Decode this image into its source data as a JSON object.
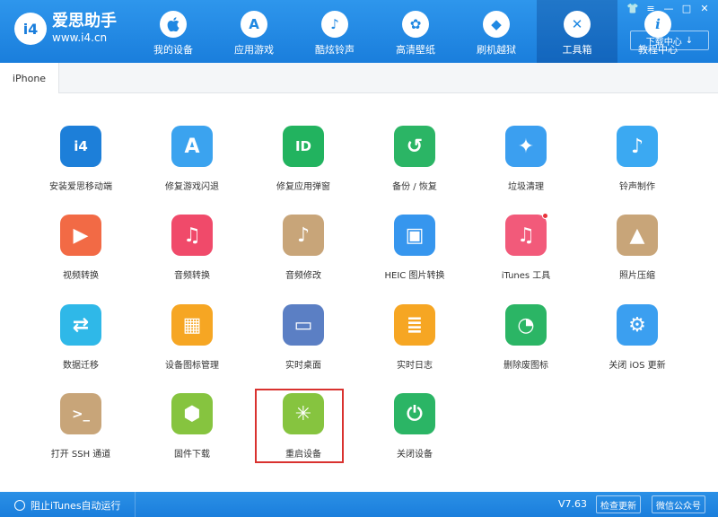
{
  "app": {
    "logo_text": "i4",
    "name": "爱思助手",
    "url": "www.i4.cn"
  },
  "nav": [
    {
      "label": "我的设备",
      "icon": "apple-icon",
      "glyph": ""
    },
    {
      "label": "应用游戏",
      "icon": "app-store-icon",
      "glyph": "A"
    },
    {
      "label": "酷炫铃声",
      "icon": "bell-icon",
      "glyph": "♪"
    },
    {
      "label": "高清壁纸",
      "icon": "flower-icon",
      "glyph": "✿"
    },
    {
      "label": "刷机越狱",
      "icon": "box-icon",
      "glyph": "◆"
    },
    {
      "label": "工具箱",
      "icon": "tools-icon",
      "glyph": "✕",
      "active": true
    },
    {
      "label": "教程中心",
      "icon": "info-icon",
      "glyph": "i"
    }
  ],
  "window_controls": {
    "shirt": "👕",
    "menu": "≡",
    "minimize": "—",
    "maximize": "□",
    "close": "✕"
  },
  "download_center": {
    "label": "下载中心",
    "arrow": "↓"
  },
  "tabs": [
    {
      "label": "iPhone"
    }
  ],
  "tools": [
    {
      "label": "安装爱思移动端",
      "icon": "i4-app-icon",
      "glyph": "i4",
      "color": "#1d7fd9"
    },
    {
      "label": "修复游戏闪退",
      "icon": "app-repair-icon",
      "glyph": "A",
      "color": "#3ba3ef"
    },
    {
      "label": "修复应用弹窗",
      "icon": "apple-id-icon",
      "glyph": "ID",
      "color": "#22b35f"
    },
    {
      "label": "备份 / 恢复",
      "icon": "backup-restore-icon",
      "glyph": "↺",
      "color": "#2bb565"
    },
    {
      "label": "垃圾清理",
      "icon": "broom-icon",
      "glyph": "✦",
      "color": "#3b9ff0"
    },
    {
      "label": "铃声制作",
      "icon": "bell-plus-icon",
      "glyph": "♪",
      "color": "#3ba9f2"
    },
    {
      "label": "视频转换",
      "icon": "video-play-icon",
      "glyph": "▶",
      "color": "#f26a45"
    },
    {
      "label": "音频转换",
      "icon": "music-note-icon",
      "glyph": "♫",
      "color": "#f04a6a"
    },
    {
      "label": "音频修改",
      "icon": "music-edit-icon",
      "glyph": "♪",
      "color": "#c8a579"
    },
    {
      "label": "HEIC 图片转换",
      "icon": "heic-convert-icon",
      "glyph": "▣",
      "color": "#3696ee"
    },
    {
      "label": "iTunes 工具",
      "icon": "itunes-icon",
      "glyph": "♫",
      "color": "#f25a7a",
      "badge": true
    },
    {
      "label": "照片压缩",
      "icon": "photo-compress-icon",
      "glyph": "▲",
      "color": "#c8a579"
    },
    {
      "label": "数据迁移",
      "icon": "data-migrate-icon",
      "glyph": "⇄",
      "color": "#2fb8e8"
    },
    {
      "label": "设备图标管理",
      "icon": "icon-grid-icon",
      "glyph": "▦",
      "color": "#f6a623"
    },
    {
      "label": "实时桌面",
      "icon": "monitor-icon",
      "glyph": "▭",
      "color": "#5b7fc4"
    },
    {
      "label": "实时日志",
      "icon": "log-document-icon",
      "glyph": "≣",
      "color": "#f6a623"
    },
    {
      "label": "删除废图标",
      "icon": "pie-delete-icon",
      "glyph": "◔",
      "color": "#2bb565"
    },
    {
      "label": "关闭 iOS 更新",
      "icon": "gear-update-icon",
      "glyph": "⚙",
      "color": "#3b9ff0"
    },
    {
      "label": "打开 SSH 通道",
      "icon": "ssh-terminal-icon",
      "glyph": ">_",
      "color": "#c8a579"
    },
    {
      "label": "固件下载",
      "icon": "firmware-box-icon",
      "glyph": "⬢",
      "color": "#86c43f"
    },
    {
      "label": "重启设备",
      "icon": "restart-spinner-icon",
      "glyph": "✳",
      "color": "#86c43f"
    },
    {
      "label": "关闭设备",
      "icon": "power-icon",
      "glyph": "⏻",
      "color": "#2bb565"
    }
  ],
  "footer": {
    "itunes_toggle": "阻止iTunes自动运行",
    "version": "V7.63",
    "check_update": "检查更新",
    "wechat": "微信公众号"
  }
}
